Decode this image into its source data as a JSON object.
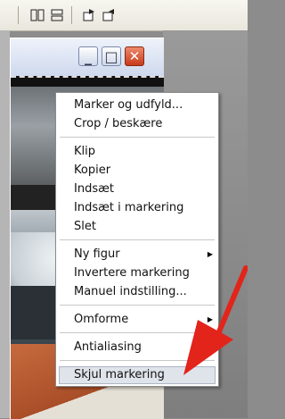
{
  "toolbar": {
    "icons": [
      "columns-icon",
      "split-view-icon",
      "export-icon",
      "import-icon"
    ]
  },
  "window_controls": {
    "minimize": "_",
    "maximize": "□",
    "close": "✕"
  },
  "context_menu": {
    "items": [
      {
        "label": "Marker og udfyld...",
        "submenu": false
      },
      {
        "label": "Crop / beskære",
        "submenu": false
      },
      {
        "label": "Klip",
        "submenu": false
      },
      {
        "label": "Kopier",
        "submenu": false
      },
      {
        "label": "Indsæt",
        "submenu": false
      },
      {
        "label": "Indsæt i markering",
        "submenu": false
      },
      {
        "label": "Slet",
        "submenu": false
      },
      {
        "label": "Ny figur",
        "submenu": true
      },
      {
        "label": "Invertere markering",
        "submenu": false
      },
      {
        "label": "Manuel indstilling...",
        "submenu": false
      },
      {
        "label": "Omforme",
        "submenu": true
      },
      {
        "label": "Antialiasing",
        "submenu": false
      },
      {
        "label": "Skjul markering",
        "submenu": false
      }
    ],
    "highlighted": "Skjul markering"
  },
  "colors": {
    "accent_arrow": "#e3241b",
    "close_button": "#d2461f",
    "highlight": "#dfe3ea"
  }
}
